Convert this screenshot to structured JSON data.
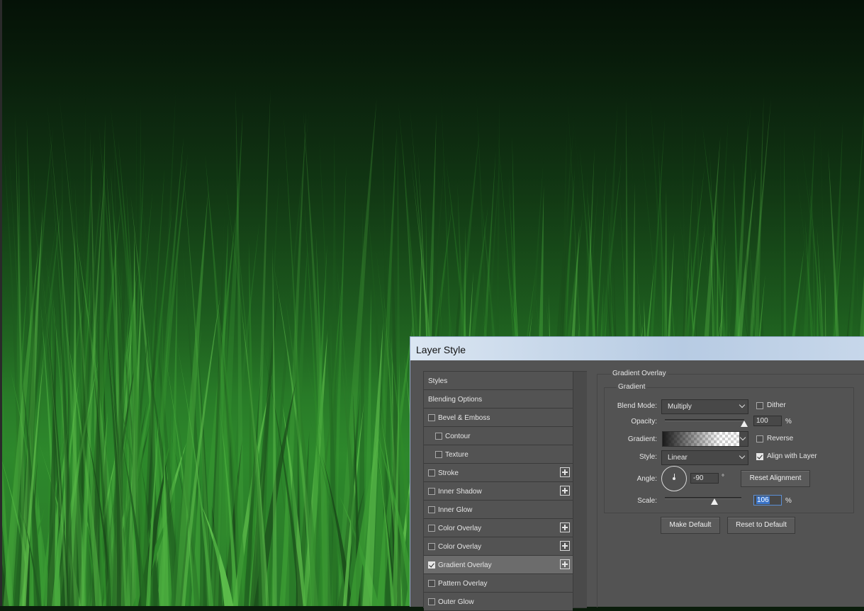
{
  "dialog": {
    "title": "Layer Style"
  },
  "styles_list": {
    "items": [
      {
        "label": "Styles",
        "checkbox": false,
        "checked": false,
        "indent": 0,
        "plus": false,
        "selected": false
      },
      {
        "label": "Blending Options",
        "checkbox": false,
        "checked": false,
        "indent": 0,
        "plus": false,
        "selected": false
      },
      {
        "label": "Bevel & Emboss",
        "checkbox": true,
        "checked": false,
        "indent": 0,
        "plus": false,
        "selected": false
      },
      {
        "label": "Contour",
        "checkbox": true,
        "checked": false,
        "indent": 1,
        "plus": false,
        "selected": false
      },
      {
        "label": "Texture",
        "checkbox": true,
        "checked": false,
        "indent": 1,
        "plus": false,
        "selected": false
      },
      {
        "label": "Stroke",
        "checkbox": true,
        "checked": false,
        "indent": 0,
        "plus": true,
        "selected": false
      },
      {
        "label": "Inner Shadow",
        "checkbox": true,
        "checked": false,
        "indent": 0,
        "plus": true,
        "selected": false
      },
      {
        "label": "Inner Glow",
        "checkbox": true,
        "checked": false,
        "indent": 0,
        "plus": false,
        "selected": false
      },
      {
        "label": "Color Overlay",
        "checkbox": true,
        "checked": false,
        "indent": 0,
        "plus": true,
        "selected": false
      },
      {
        "label": "Color Overlay",
        "checkbox": true,
        "checked": false,
        "indent": 0,
        "plus": true,
        "selected": false
      },
      {
        "label": "Gradient Overlay",
        "checkbox": true,
        "checked": true,
        "indent": 0,
        "plus": true,
        "selected": true
      },
      {
        "label": "Pattern Overlay",
        "checkbox": true,
        "checked": false,
        "indent": 0,
        "plus": false,
        "selected": false
      },
      {
        "label": "Outer Glow",
        "checkbox": true,
        "checked": false,
        "indent": 0,
        "plus": false,
        "selected": false
      }
    ]
  },
  "gradient_overlay": {
    "section_title": "Gradient Overlay",
    "group_title": "Gradient",
    "blend_mode_label": "Blend Mode:",
    "blend_mode_value": "Multiply",
    "dither_label": "Dither",
    "dither_checked": false,
    "opacity_label": "Opacity:",
    "opacity_value": "100",
    "opacity_unit": "%",
    "opacity_fraction": 1.0,
    "gradient_label": "Gradient:",
    "reverse_label": "Reverse",
    "reverse_checked": false,
    "style_label": "Style:",
    "style_value": "Linear",
    "align_label": "Align with Layer",
    "align_checked": true,
    "angle_label": "Angle:",
    "angle_value": "-90",
    "angle_unit": "°",
    "reset_alignment_label": "Reset Alignment",
    "scale_label": "Scale:",
    "scale_value": "106",
    "scale_unit": "%",
    "scale_fraction": 0.65,
    "make_default_label": "Make Default",
    "reset_default_label": "Reset to Default"
  }
}
